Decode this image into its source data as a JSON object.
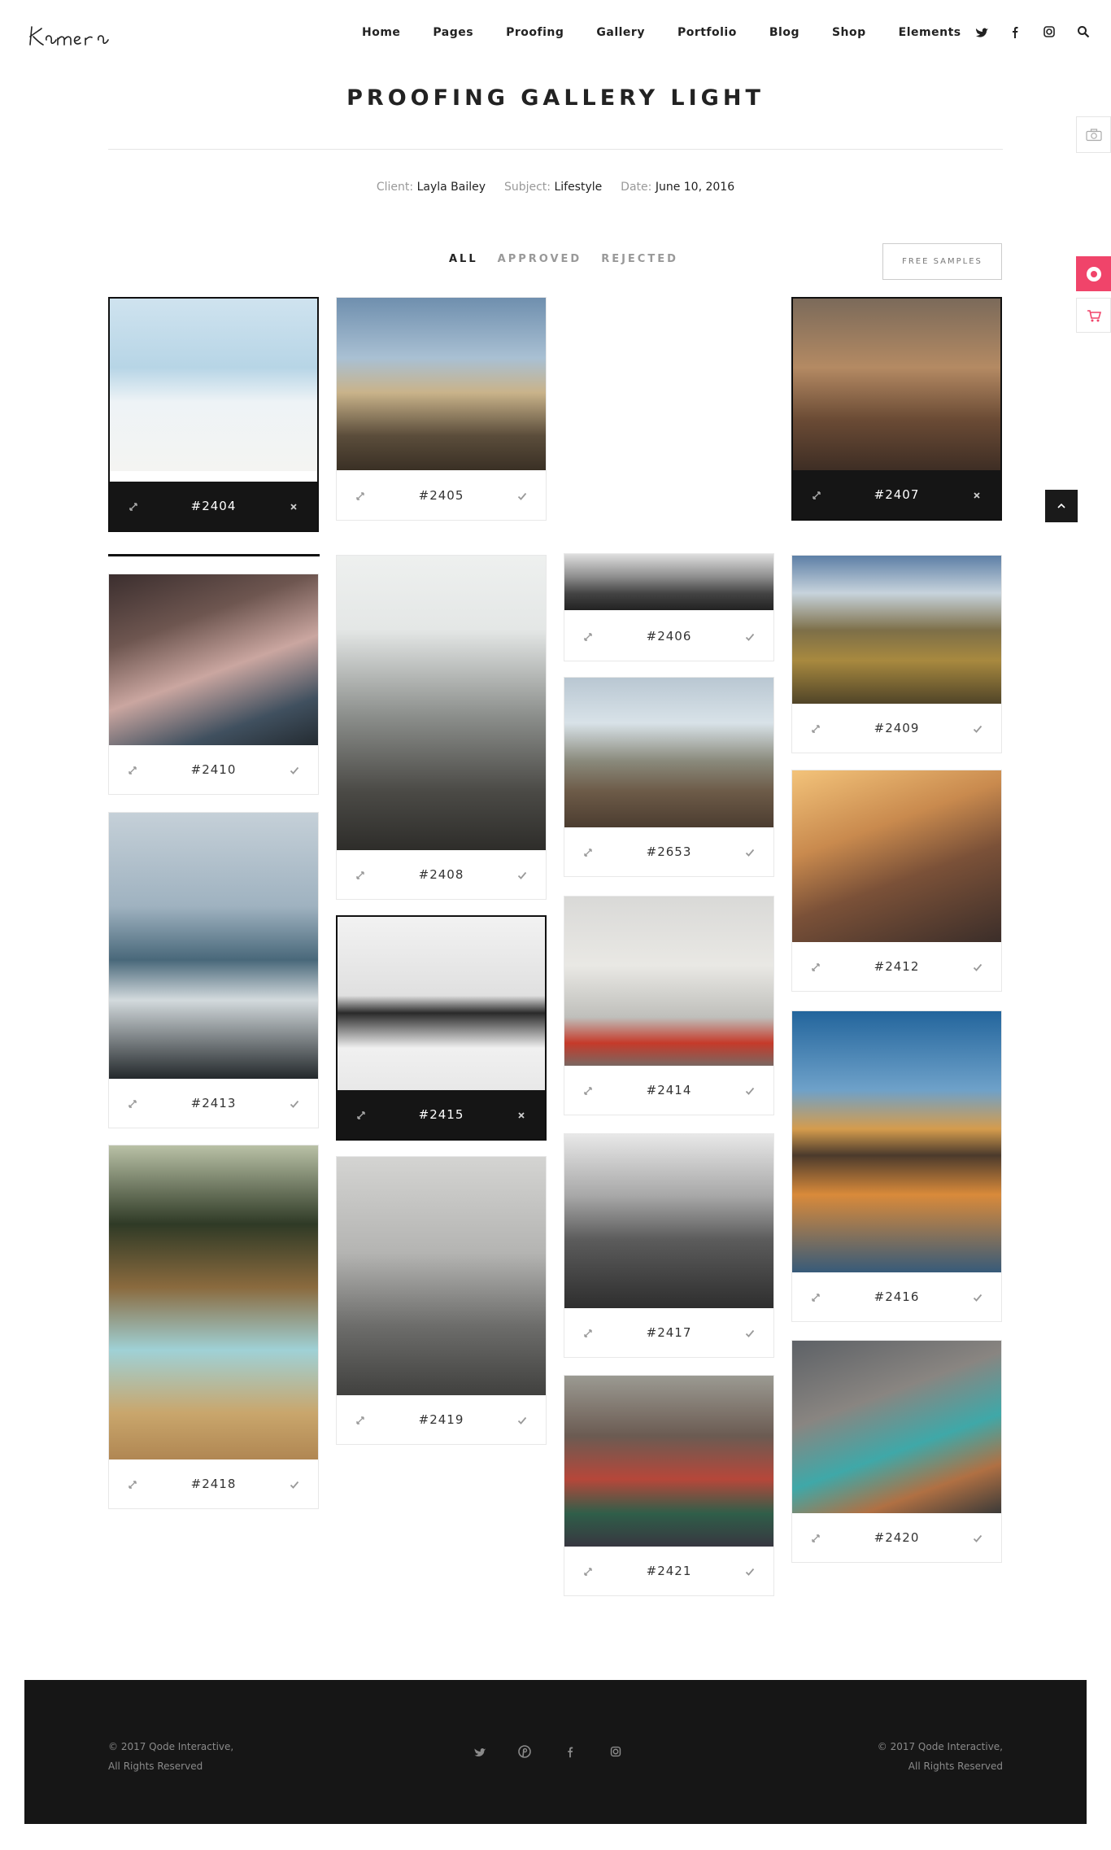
{
  "header": {
    "logo_text": "Kamera",
    "nav": [
      "Home",
      "Pages",
      "Proofing",
      "Gallery",
      "Portfolio",
      "Blog",
      "Shop",
      "Elements"
    ],
    "icons": [
      "twitter-icon",
      "facebook-icon",
      "instagram-icon",
      "search-icon"
    ]
  },
  "page": {
    "title": "PROOFING GALLERY LIGHT",
    "client_label": "Client:",
    "client_value": "Layla Bailey",
    "subject_label": "Subject:",
    "subject_value": "Lifestyle",
    "date_label": "Date:",
    "date_value": "June 10, 2016"
  },
  "filters": [
    "ALL",
    "APPROVED",
    "REJECTED"
  ],
  "active_filter": "ALL",
  "free_samples": "FREE SAMPLES",
  "gallery": [
    {
      "id": "#2404",
      "status": "rejected"
    },
    {
      "id": "#2405",
      "status": "approved"
    },
    {
      "id": "#2406",
      "status": "approved"
    },
    {
      "id": "#2407",
      "status": "rejected"
    },
    {
      "id": "#2410",
      "status": "approved"
    },
    {
      "id": "#2408",
      "status": "approved"
    },
    {
      "id": "#2653",
      "status": "approved"
    },
    {
      "id": "#2409",
      "status": "approved"
    },
    {
      "id": "#2413",
      "status": "approved"
    },
    {
      "id": "#2415",
      "status": "rejected"
    },
    {
      "id": "#2414",
      "status": "approved"
    },
    {
      "id": "#2412",
      "status": "approved"
    },
    {
      "id": "#2418",
      "status": "approved"
    },
    {
      "id": "#2419",
      "status": "approved"
    },
    {
      "id": "#2417",
      "status": "approved"
    },
    {
      "id": "#2416",
      "status": "approved"
    },
    {
      "id": "#2421",
      "status": "approved"
    },
    {
      "id": "#2420",
      "status": "approved"
    }
  ],
  "footer": {
    "left_line1": "© 2017 Qode Interactive,",
    "left_line2": "All Rights Reserved",
    "right_line1": "© 2017 Qode Interactive,",
    "right_line2": "All Rights Reserved",
    "icons": [
      "twitter-icon",
      "pinterest-icon",
      "facebook-icon",
      "instagram-icon"
    ]
  },
  "colors": {
    "accent": "#f0446a",
    "dark": "#151515",
    "muted": "#999999"
  }
}
